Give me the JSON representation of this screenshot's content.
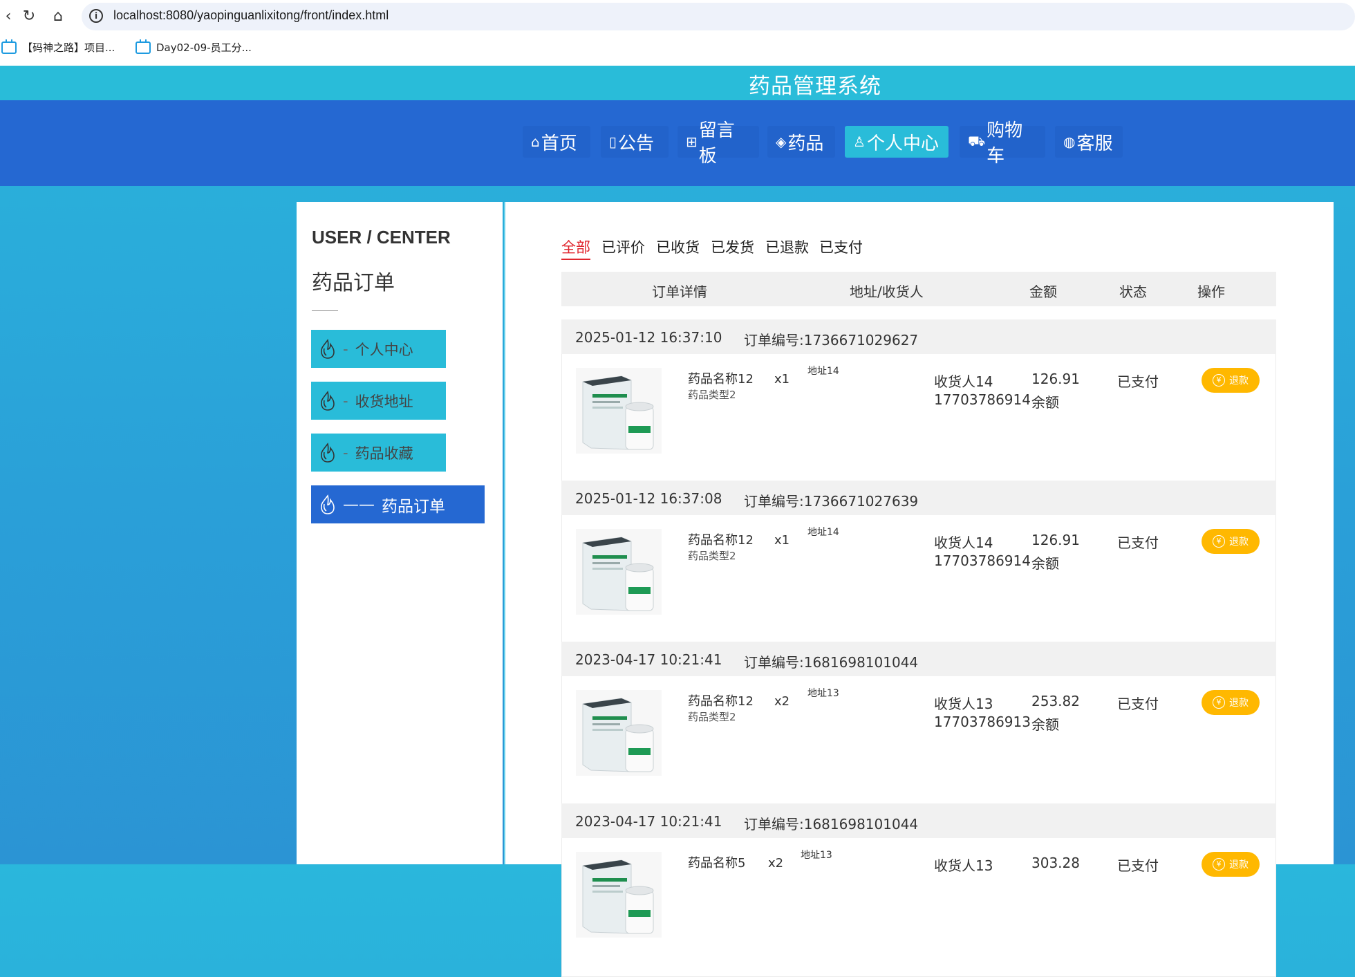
{
  "browser": {
    "url": "localhost:8080/yaopinguanlixitong/front/index.html",
    "bookmarks": [
      "【码神之路】项目...",
      "Day02-09-员工分..."
    ]
  },
  "site": {
    "title": "药品管理系统"
  },
  "nav": [
    {
      "label": "首页",
      "icon": "⌂"
    },
    {
      "label": "公告",
      "icon": "▯"
    },
    {
      "label": "留言板",
      "icon": "⊞"
    },
    {
      "label": "药品",
      "icon": "◈"
    },
    {
      "label": "个人中心",
      "icon": "♙"
    },
    {
      "label": "购物车",
      "icon": "⛟"
    },
    {
      "label": "客服",
      "icon": "◍"
    }
  ],
  "user_center": {
    "title": "USER / CENTER",
    "subtitle": "药品订单",
    "menu": [
      {
        "label": "个人中心",
        "dash": "-"
      },
      {
        "label": "收货地址",
        "dash": "-"
      },
      {
        "label": "药品收藏",
        "dash": "-"
      },
      {
        "label": "药品订单",
        "dash": "——"
      }
    ]
  },
  "tabs": [
    "全部",
    "已评价",
    "已收货",
    "已发货",
    "已退款",
    "已支付"
  ],
  "table_headers": [
    "订单详情",
    "地址/收货人",
    "金额",
    "状态",
    "操作"
  ],
  "orders": [
    {
      "date": "2025-01-12 16:37:10",
      "order_no": "订单编号:1736671029627",
      "name": "药品名称12",
      "type": "药品类型2",
      "qty": "x1",
      "address": "地址14",
      "receiver": "收货人14",
      "phone": "17703786914",
      "amount": "126.91",
      "pay": "余额",
      "status": "已支付",
      "action": "退款"
    },
    {
      "date": "2025-01-12 16:37:08",
      "order_no": "订单编号:1736671027639",
      "name": "药品名称12",
      "type": "药品类型2",
      "qty": "x1",
      "address": "地址14",
      "receiver": "收货人14",
      "phone": "17703786914",
      "amount": "126.91",
      "pay": "余额",
      "status": "已支付",
      "action": "退款"
    },
    {
      "date": "2023-04-17 10:21:41",
      "order_no": "订单编号:1681698101044",
      "name": "药品名称12",
      "type": "药品类型2",
      "qty": "x2",
      "address": "地址13",
      "receiver": "收货人13",
      "phone": "17703786913",
      "amount": "253.82",
      "pay": "余额",
      "status": "已支付",
      "action": "退款"
    },
    {
      "date": "2023-04-17 10:21:41",
      "order_no": "订单编号:1681698101044",
      "name": "药品名称5",
      "type": "",
      "qty": "x2",
      "address": "地址13",
      "receiver": "收货人13",
      "phone": "",
      "amount": "303.28",
      "pay": "",
      "status": "已支付",
      "action": "退款"
    }
  ],
  "colors": {
    "cyan": "#29bcd9",
    "blue": "#2568d2",
    "refund": "#ffb800",
    "active_tab": "#e0262e"
  }
}
